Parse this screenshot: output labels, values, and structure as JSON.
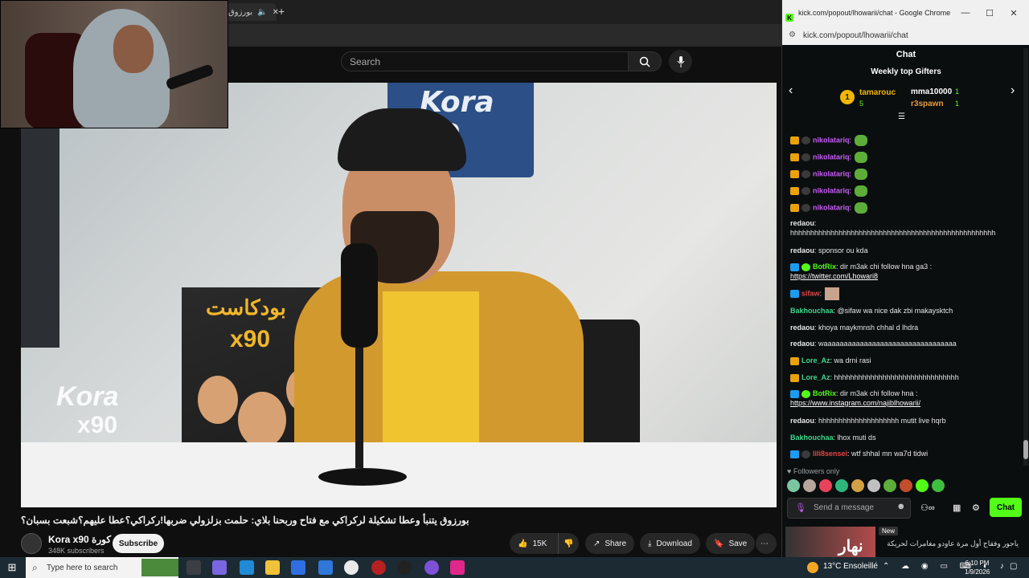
{
  "youtube": {
    "tab": {
      "title": "بورزوق",
      "close_label": "✕",
      "new_tab_label": "+"
    },
    "search": {
      "placeholder": "Search"
    },
    "video": {
      "title": "بورزوق يتنبأ وعطا تشكيلة لركراكي مع فتاح وربحنا بلاي: حلمت بزلزولي ضربها!ركراكي؟عطا عليهم؟شبعت بسبان؟",
      "sign_text": "Kora 90",
      "poster_title": "بودكاست",
      "poster_x90": "x90",
      "watermark_top": "Kora",
      "watermark_bottom": "x90"
    },
    "channel": {
      "name": "Kora x90 كورة",
      "subscribers": "348K subscribers",
      "subscribe_label": "Subscribe"
    },
    "actions": {
      "likes": "15K",
      "share": "Share",
      "download": "Download",
      "save": "Save"
    }
  },
  "chat_window": {
    "title": "kick.com/popout/lhowarii/chat - Google Chrome",
    "url": "kick.com/popout/lhowarii/chat",
    "header": "Chat",
    "gifters": {
      "title": "Weekly top Gifters",
      "rank1": {
        "rank": "1",
        "name": "tamarouc",
        "count": "5"
      },
      "rank2": {
        "name": "mma10000",
        "count": "1"
      },
      "rank3": {
        "name": "r3spawn",
        "count": "1"
      }
    },
    "messages": [
      {
        "user": "nikolatariq",
        "text": "",
        "color": "#c85bf7",
        "emote": true
      },
      {
        "user": "nikolatariq",
        "text": "",
        "color": "#c85bf7",
        "emote": true
      },
      {
        "user": "nikolatariq",
        "text": "",
        "color": "#c85bf7",
        "emote": true
      },
      {
        "user": "nikolatariq",
        "text": "",
        "color": "#c85bf7",
        "emote": true
      },
      {
        "user": "nikolatariq",
        "text": "",
        "color": "#c85bf7",
        "emote": true
      },
      {
        "user": "redaou",
        "text": "hhhhhhhhhhhhhhhhhhhhhhhhhhhhhhhhhhhhhhhhhhhhhhhhhhh",
        "color": "#e6e6e6"
      },
      {
        "user": "redaou",
        "text": "sponsor ou kda",
        "color": "#e6e6e6"
      },
      {
        "user": "BotRix",
        "text": "dir m3ak chi follow hna ga3 :",
        "link": "https://twitter.com/Lhowari8",
        "color": "#53fc18"
      },
      {
        "user": "sifaw",
        "text": "",
        "color": "#e04848"
      },
      {
        "user": "Bakhouchaa",
        "text": "@sifaw wa nice dak zbi makaysktch",
        "color": "#3dd68c"
      },
      {
        "user": "redaou",
        "text": "khoya maykmnsh chhal d lhdra",
        "color": "#e6e6e6"
      },
      {
        "user": "redaou",
        "text": "waaaaaaaaaaaaaaaaaaaaaaaaaaaaaaaaa",
        "color": "#e6e6e6"
      },
      {
        "user": "Lore_Az",
        "text": "wa drni rasi",
        "color": "#3dd68c"
      },
      {
        "user": "Lore_Az",
        "text": "hhhhhhhhhhhhhhhhhhhhhhhhhhhhhhh",
        "color": "#3dd68c"
      },
      {
        "user": "BotRix",
        "text": "dir m3ak chi follow hna :",
        "link": "https://www.instagram.com/najiblhowarii/",
        "color": "#53fc18"
      },
      {
        "user": "redaou",
        "text": "hhhhhhhhhhhhhhhhhhhh mutit live hqrb",
        "color": "#e6e6e6"
      },
      {
        "user": "Bakhouchaa",
        "text": "lhox muti ds",
        "color": "#3dd68c"
      },
      {
        "user": "lili8sensei",
        "text": "wtf shhal mn wa7d tidwi",
        "color": "#e04848"
      }
    ],
    "followers_only": "Followers only",
    "input_placeholder": "Send a message",
    "send_label": "Chat",
    "recommendation": {
      "badge": "New",
      "text": "ياجور وفقاح أول مرة عاودو مغامرات لحريكة",
      "brand": "نهار"
    }
  },
  "taskbar": {
    "search_placeholder": "Type here to search",
    "weather": "13°C  Ensoleillé",
    "time": "6:10 PM",
    "date": "1/9/2026"
  },
  "colors": {
    "kick_green": "#53fc18",
    "youtube_bg": "#0f0f0f"
  }
}
